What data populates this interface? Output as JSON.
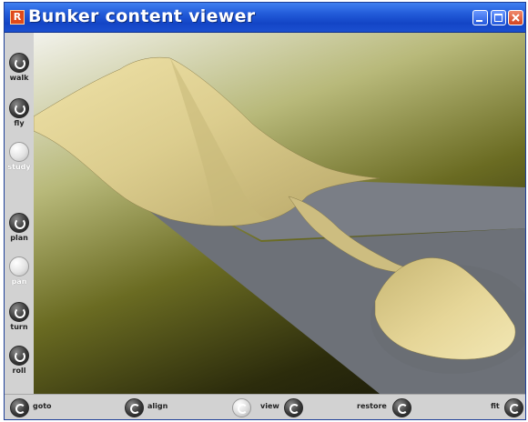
{
  "window": {
    "app_icon_letter": "R",
    "title": "Bunker content viewer"
  },
  "left_toolbar": {
    "items": [
      {
        "label": "walk",
        "icon": "walk-icon",
        "active": false
      },
      {
        "label": "fly",
        "icon": "fly-icon",
        "active": false
      },
      {
        "label": "study",
        "icon": "study-icon",
        "active": true
      },
      {
        "label": "plan",
        "icon": "plan-icon",
        "active": false
      },
      {
        "label": "pan",
        "icon": "pan-icon",
        "active": true
      },
      {
        "label": "turn",
        "icon": "turn-icon",
        "active": false
      },
      {
        "label": "roll",
        "icon": "roll-icon",
        "active": false
      }
    ]
  },
  "bottom_toolbar": {
    "goto_label": "goto",
    "align_label": "align",
    "view_label": "view",
    "restore_label": "restore",
    "fit_label": "fit"
  },
  "colors": {
    "titlebar": "#2159d8",
    "terrain": "#d8c98a",
    "ground_plane": "#6d7178",
    "background_dark": "#16160a",
    "background_light": "#f2f2ec"
  }
}
